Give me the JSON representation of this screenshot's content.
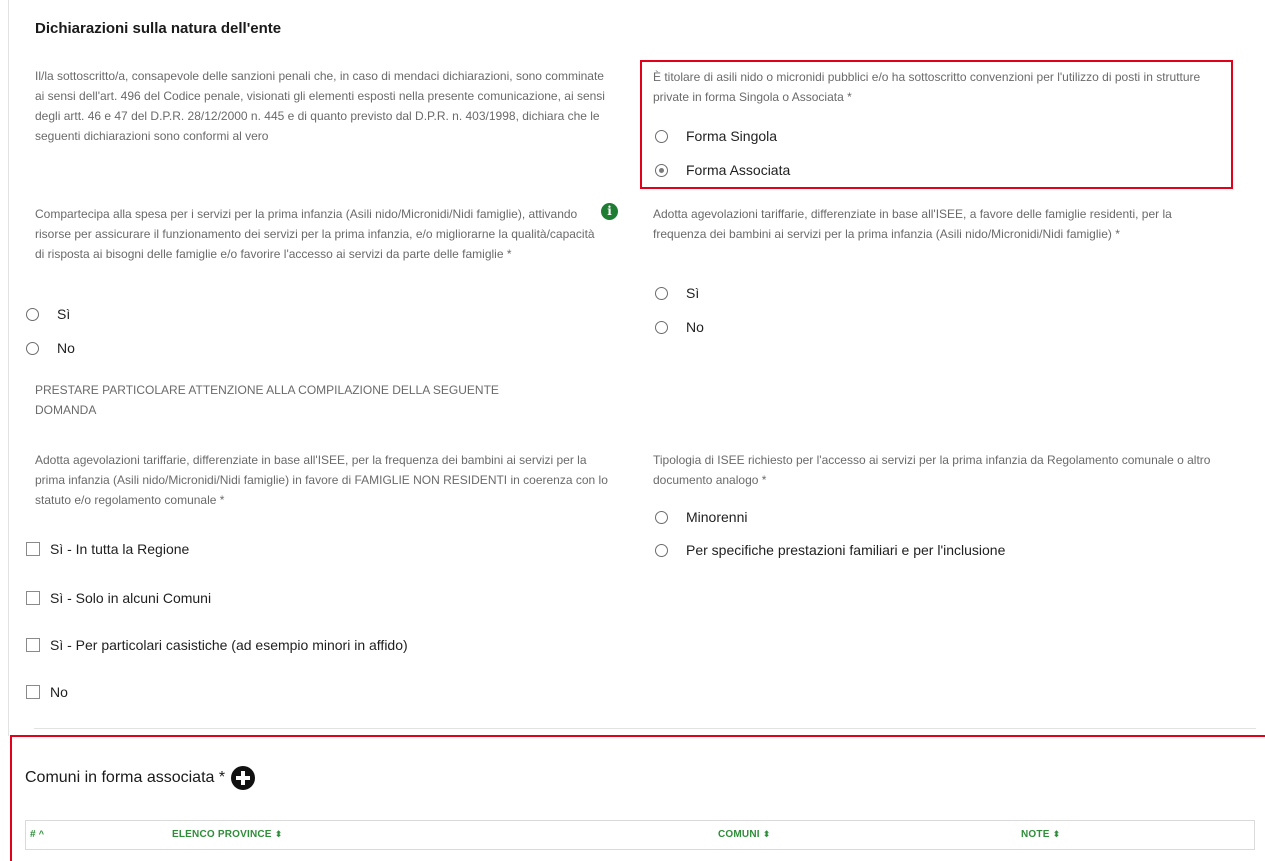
{
  "section": {
    "title": "Dichiarazioni sulla natura dell'ente",
    "intro": "Il/la sottoscritto/a, consapevole delle sanzioni penali che, in caso di mendaci dichiarazioni, sono comminate ai sensi dell'art. 496 del Codice penale, visionati gli elementi esposti nella presente comunicazione, ai sensi degli artt. 46 e 47 del D.P.R. 28/12/2000 n. 445 e di quanto previsto dal D.P.R. n. 403/1998, dichiara che le seguenti dichiarazioni sono conformi al vero"
  },
  "q_titolare": {
    "label": "È titolare di asili nido o micronidi pubblici e/o ha sottoscritto convenzioni per l'utilizzo di posti in strutture private in forma Singola o Associata *",
    "options": [
      "Forma Singola",
      "Forma Associata"
    ],
    "selected": "Forma Associata"
  },
  "q_compartecipa": {
    "label": "Compartecipa alla spesa per i servizi per la prima infanzia (Asili nido/Micronidi/Nidi famiglie), attivando risorse per assicurare il funzionamento dei servizi per la prima infanzia, e/o migliorarne la qualità/capacità di risposta ai bisogni delle famiglie e/o favorire l'accesso ai servizi da parte delle famiglie *",
    "info_glyph": "i",
    "options": [
      "Sì",
      "No"
    ]
  },
  "q_agevolazioni_residenti": {
    "label": "Adotta agevolazioni tariffarie, differenziate in base all'ISEE, a favore delle famiglie residenti, per la frequenza dei bambini ai servizi per la prima infanzia (Asili nido/Micronidi/Nidi famiglie) *",
    "options": [
      "Sì",
      "No"
    ]
  },
  "attention_note": "PRESTARE PARTICOLARE ATTENZIONE ALLA COMPILAZIONE DELLA SEGUENTE DOMANDA",
  "q_non_residenti": {
    "label": "Adotta agevolazioni tariffarie, differenziate in base all'ISEE, per la frequenza dei bambini ai servizi per la prima infanzia (Asili nido/Micronidi/Nidi famiglie) in favore di FAMIGLIE NON RESIDENTI in coerenza con lo statuto e/o regolamento comunale *",
    "options": [
      "Sì - In tutta la Regione",
      "Sì - Solo in alcuni Comuni",
      "Sì - Per particolari casistiche (ad esempio minori in affido)",
      "No"
    ]
  },
  "q_isee": {
    "label": "Tipologia di ISEE richiesto per l'accesso ai servizi per la prima infanzia da Regolamento comunale o altro documento analogo *",
    "options": [
      "Minorenni",
      "Per specifiche prestazioni familiari e per l'inclusione"
    ]
  },
  "comuni": {
    "title": "Comuni in forma associata *",
    "columns": [
      "#",
      "ELENCO PROVINCE",
      "COMUNI",
      "NOTE"
    ],
    "sort_icons": [
      "^",
      "⬍",
      "⬍",
      "⬍"
    ]
  },
  "colors": {
    "accent": "#2f8d3a",
    "highlight": "#e3001b",
    "info": "#1e7d32"
  }
}
